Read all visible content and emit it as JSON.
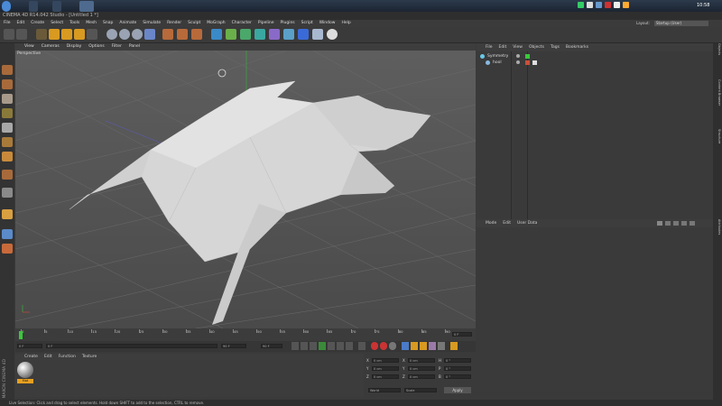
{
  "titlebar": {
    "title": "CINEMA 4D R14.042 Studio - [Untitled 1 *]"
  },
  "taskbar": {
    "clock": "10:58"
  },
  "menu": [
    "File",
    "Edit",
    "Create",
    "Select",
    "Tools",
    "Mesh",
    "Snap",
    "Animate",
    "Simulate",
    "Render",
    "Sculpt",
    "MoGraph",
    "Character",
    "Pipeline",
    "Plugins",
    "Script",
    "Window",
    "Help"
  ],
  "layout": {
    "label": "Layout:",
    "value": "Startup (User)"
  },
  "viewport": {
    "menu": [
      "View",
      "Cameras",
      "Display",
      "Options",
      "Filter",
      "Panel"
    ],
    "label": "Perspective"
  },
  "timeline": {
    "ticks": [
      "0",
      "5",
      "10",
      "15",
      "20",
      "25",
      "30",
      "35",
      "40",
      "45",
      "50",
      "55",
      "60",
      "65",
      "70",
      "75",
      "80",
      "85",
      "90"
    ],
    "end_field": "0 F"
  },
  "playbar": {
    "start": "0 F",
    "current": "0 F",
    "max": "90 F",
    "end": "90 F"
  },
  "objects": {
    "menu": [
      "File",
      "Edit",
      "View",
      "Objects",
      "Tags",
      "Bookmarks"
    ],
    "items": [
      {
        "name": "Symmetry"
      },
      {
        "name": "hool"
      }
    ]
  },
  "attributes": {
    "menu": [
      "Mode",
      "Edit",
      "User Data"
    ]
  },
  "materials": {
    "menu": [
      "Create",
      "Edit",
      "Function",
      "Texture"
    ],
    "mat_label": "Mat"
  },
  "coords": {
    "rows": [
      {
        "a": "X",
        "v1": "0 cm",
        "b": "X",
        "v2": "0 cm",
        "c": "H",
        "v3": "0 °"
      },
      {
        "a": "Y",
        "v1": "0 cm",
        "b": "Y",
        "v2": "0 cm",
        "c": "P",
        "v3": "0 °"
      },
      {
        "a": "Z",
        "v1": "0 cm",
        "b": "Z",
        "v2": "0 cm",
        "c": "B",
        "v3": "0 °"
      }
    ],
    "mode1": "World",
    "mode2": "Scale",
    "apply": "Apply"
  },
  "statusbar": {
    "text": "Live Selection: Click and drag to select elements. Hold down SHIFT to add to the selection, CTRL to remove."
  },
  "righttabs": [
    "Objects",
    "Content Browser",
    "Structure",
    "Attributes"
  ],
  "brand": "MAXON CINEMA 4D"
}
